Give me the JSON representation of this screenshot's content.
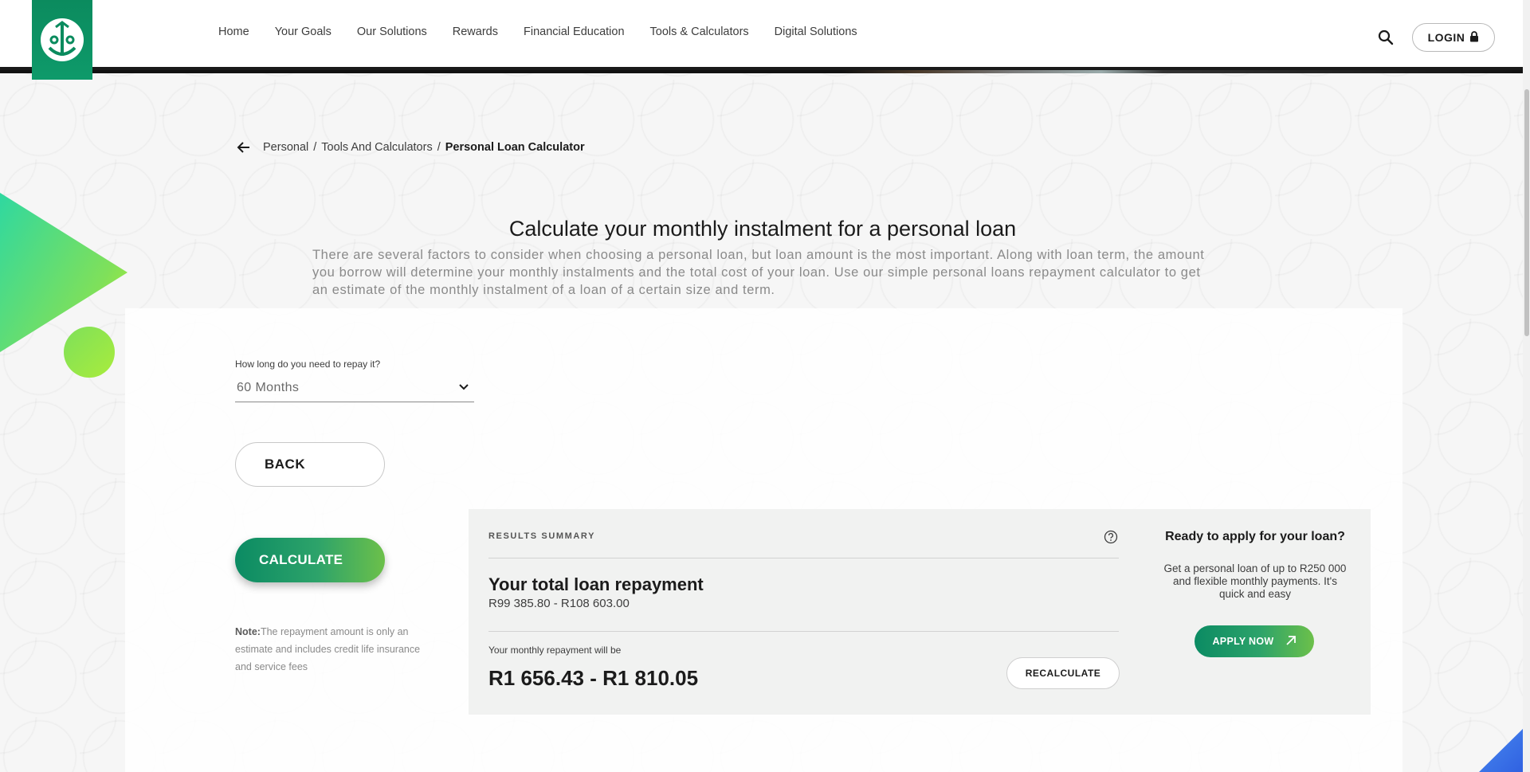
{
  "nav": {
    "items": [
      "Home",
      "Your Goals",
      "Our Solutions",
      "Rewards",
      "Financial Education",
      "Tools & Calculators",
      "Digital Solutions"
    ],
    "login_label": "LOGIN"
  },
  "breadcrumb": {
    "items": [
      "Personal",
      "Tools And Calculators"
    ],
    "current": "Personal Loan Calculator",
    "separator": "/"
  },
  "intro": {
    "title": "Calculate your monthly instalment for a personal loan",
    "text": "There are several factors to consider when choosing a personal loan, but loan amount is the most important. Along with loan term, the amount you borrow will determine your monthly instalments and the total cost of your loan. Use our simple personal loans repayment calculator to get an estimate of the monthly instalment of a loan of a certain size and term."
  },
  "form": {
    "term_label": "How long do you need to repay it?",
    "term_value": "60 Months",
    "back_label": "BACK",
    "calculate_label": "CALCULATE",
    "note_prefix": "Note:",
    "note_text": "The repayment amount is only an estimate and includes credit life insurance and service fees"
  },
  "results": {
    "heading": "RESULTS SUMMARY",
    "total_title": "Your total loan repayment",
    "total_range": "R99 385.80 - R108 603.00",
    "monthly_label": "Your monthly repayment will be",
    "monthly_value": "R1 656.43 - R1 810.05",
    "recalculate_label": "RECALCULATE"
  },
  "apply": {
    "title": "Ready to apply for your loan?",
    "text": "Get a personal loan of up to R250 000 and flexible monthly payments. It's quick and easy",
    "button_label": "APPLY NOW"
  },
  "colors": {
    "brand_green": "#0b8b63",
    "accent_lime": "#6cc04a",
    "accent_blue": "#2e5ee0"
  }
}
